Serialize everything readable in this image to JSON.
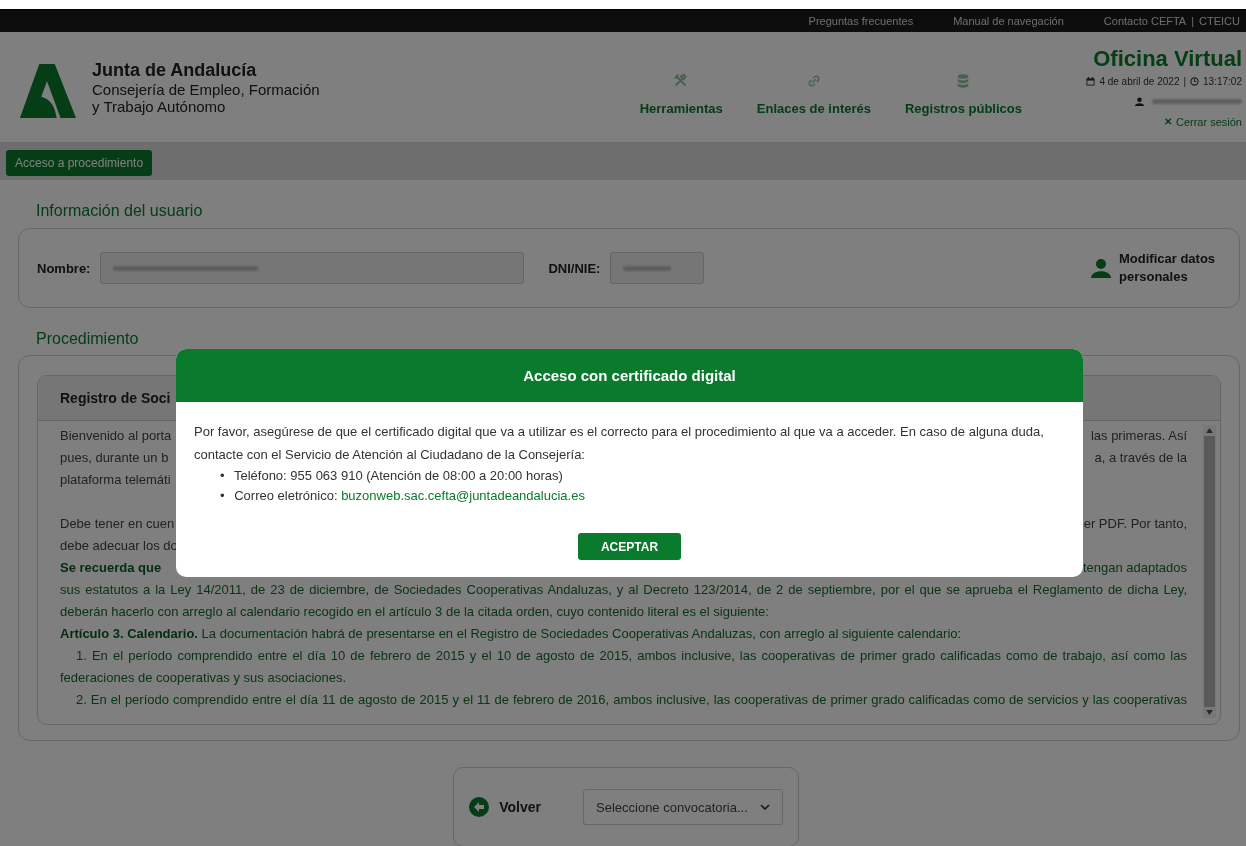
{
  "top_bar": {
    "links": [
      "Preguntas frecuentes",
      "Manual de navegación",
      "Contacto CEFTA",
      "CTEICU"
    ],
    "separator": "|"
  },
  "header": {
    "org": "Junta de Andalucía",
    "department_lines": [
      "Consejería de Empleo, Formación",
      "y Trabajo Autónomo"
    ],
    "nav": [
      {
        "label": "Herramientas"
      },
      {
        "label": "Enlaces de interés"
      },
      {
        "label": "Registros públicos"
      }
    ],
    "title": "Oficina Virtual",
    "date": "4 de abril de 2022",
    "separator": "|",
    "time": "13:17:02",
    "logout_mark": "✕",
    "logout": "Cerrar sesión"
  },
  "toolbar": {
    "button": "Acceso a procedimiento"
  },
  "user_info": {
    "title": "Información del usuario",
    "name_label": "Nombre:",
    "id_label": "DNI/NIE:",
    "edit_link": "Modificar datos personales"
  },
  "procedure": {
    "title": "Procedimiento",
    "card_title": "Registro de Soci",
    "lines": [
      {
        "kind": "split",
        "left": "Bienvenido al porta",
        "right": "las primeras. Así"
      },
      {
        "kind": "split",
        "left": "pues, durante un b",
        "right": "a, a través de la"
      },
      {
        "kind": "split",
        "left": "plataforma telemáti"
      },
      {
        "kind": "blank"
      },
      {
        "kind": "split",
        "left": "Debe tener en cuen",
        "right": "er PDF. Por tanto,"
      },
      {
        "kind": "split",
        "left": "debe adecuar los do"
      },
      {
        "kind": "notice_split",
        "left": "**Se recuerda que**",
        "right": "tengan adaptados"
      },
      {
        "kind": "notice_justified",
        "text": "sus estatutos a la Ley 14/2011, de 23 de diciembre, de Sociedades Cooperativas Andaluzas, y al Decreto 123/2014, de 2 de septiembre, por el que se aprueba el Reglamento de dicha Ley,"
      },
      {
        "kind": "notice",
        "text": "deberán hacerlo con arreglo al calendario recogido en el artículo 3 de la citada orden, cuyo contenido literal es el siguiente:"
      },
      {
        "kind": "notice",
        "text": "**Artículo 3. Calendario.** La documentación habrá de presentarse en el Registro de Sociedades Cooperativas Andaluzas, con arreglo al siguiente calendario:"
      },
      {
        "kind": "notice_indented",
        "text": "1. En el período comprendido entre el día 10 de febrero de 2015 y el 10 de agosto de 2015, ambos inclusive, las cooperativas de primer grado calificadas como de trabajo, así como las"
      },
      {
        "kind": "notice",
        "text": "federaciones de cooperativas y sus asociaciones."
      },
      {
        "kind": "notice_indented",
        "text": "2. En el período comprendido entre el día 11 de agosto de 2015 y el 11 de febrero de 2016, ambos inclusive, las cooperativas de primer grado calificadas como de servicios y las cooperativas"
      }
    ]
  },
  "footer": {
    "back": "Volver",
    "select_placeholder": "Seleccione convocatoria..."
  },
  "modal": {
    "title": "Acceso con certificado digital",
    "text": "Por favor, asegúrese de que el certificado digital que va a utilizar es el correcto para el procedimiento al que va a acceder. En caso de alguna duda, contacte con el Servicio de Atención al Ciudadano de la Consejería:",
    "items": [
      {
        "marker": "•",
        "label": "Teléfono: 955 063 910 (Atención de 08:00 a 20:00 horas)"
      },
      {
        "marker": "•",
        "label": "Correo eletrónico:",
        "link": "buzonweb.sac.cefta@juntadeandalucia.es"
      }
    ],
    "button": "ACEPTAR"
  }
}
